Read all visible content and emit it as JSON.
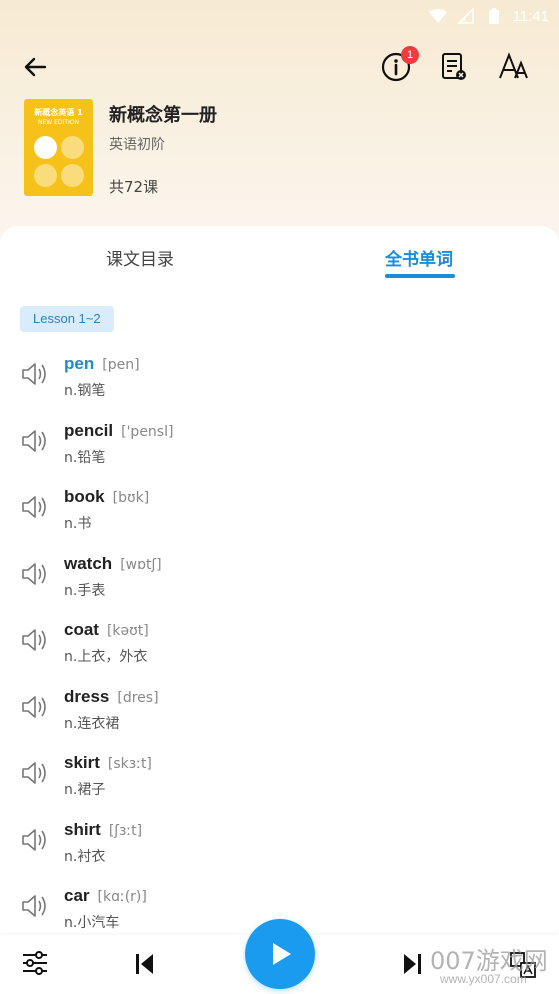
{
  "status_bar": {
    "time": "11:41"
  },
  "header": {
    "notification_count": "1"
  },
  "book": {
    "cover_title": "新概念英语 1",
    "cover_subtitle": "NEW EDITION",
    "title": "新概念第一册",
    "level": "英语初阶",
    "lesson_count": "共72课"
  },
  "tabs": [
    {
      "label": "课文目录",
      "active": false
    },
    {
      "label": "全书单词",
      "active": true
    }
  ],
  "lesson_tag": "Lesson 1~2",
  "words": [
    {
      "word": "pen",
      "phonetic": "[pen]",
      "meaning": "n.钢笔",
      "active": true
    },
    {
      "word": "pencil",
      "phonetic": "['pensl]",
      "meaning": "n.铅笔",
      "active": false
    },
    {
      "word": "book",
      "phonetic": "[bʊk]",
      "meaning": "n.书",
      "active": false
    },
    {
      "word": "watch",
      "phonetic": "[wɒtʃ]",
      "meaning": "n.手表",
      "active": false
    },
    {
      "word": "coat",
      "phonetic": "[kəʊt]",
      "meaning": "n.上衣，外衣",
      "active": false
    },
    {
      "word": "dress",
      "phonetic": "[dres]",
      "meaning": "n.连衣裙",
      "active": false
    },
    {
      "word": "skirt",
      "phonetic": "[skɜːt]",
      "meaning": "n.裙子",
      "active": false
    },
    {
      "word": "shirt",
      "phonetic": "[ʃɜːt]",
      "meaning": "n.衬衣",
      "active": false
    },
    {
      "word": "car",
      "phonetic": "[kɑː(r)]",
      "meaning": "n.小汽车",
      "active": false
    }
  ],
  "watermark": {
    "main": "007游戏网",
    "sub": "www.yx007.com"
  },
  "colors": {
    "accent": "#1a8cd8",
    "play": "#1a9bf0",
    "cover": "#f6c21a",
    "badge": "#f03c3c"
  },
  "icons": {
    "back": "arrow-left-icon",
    "info": "info-icon",
    "clear_list": "list-clear-icon",
    "font": "font-size-icon",
    "speaker": "speaker-icon",
    "settings": "sliders-icon",
    "prev": "skip-previous-icon",
    "play": "play-icon",
    "next": "skip-next-icon",
    "translate": "translate-icon"
  }
}
